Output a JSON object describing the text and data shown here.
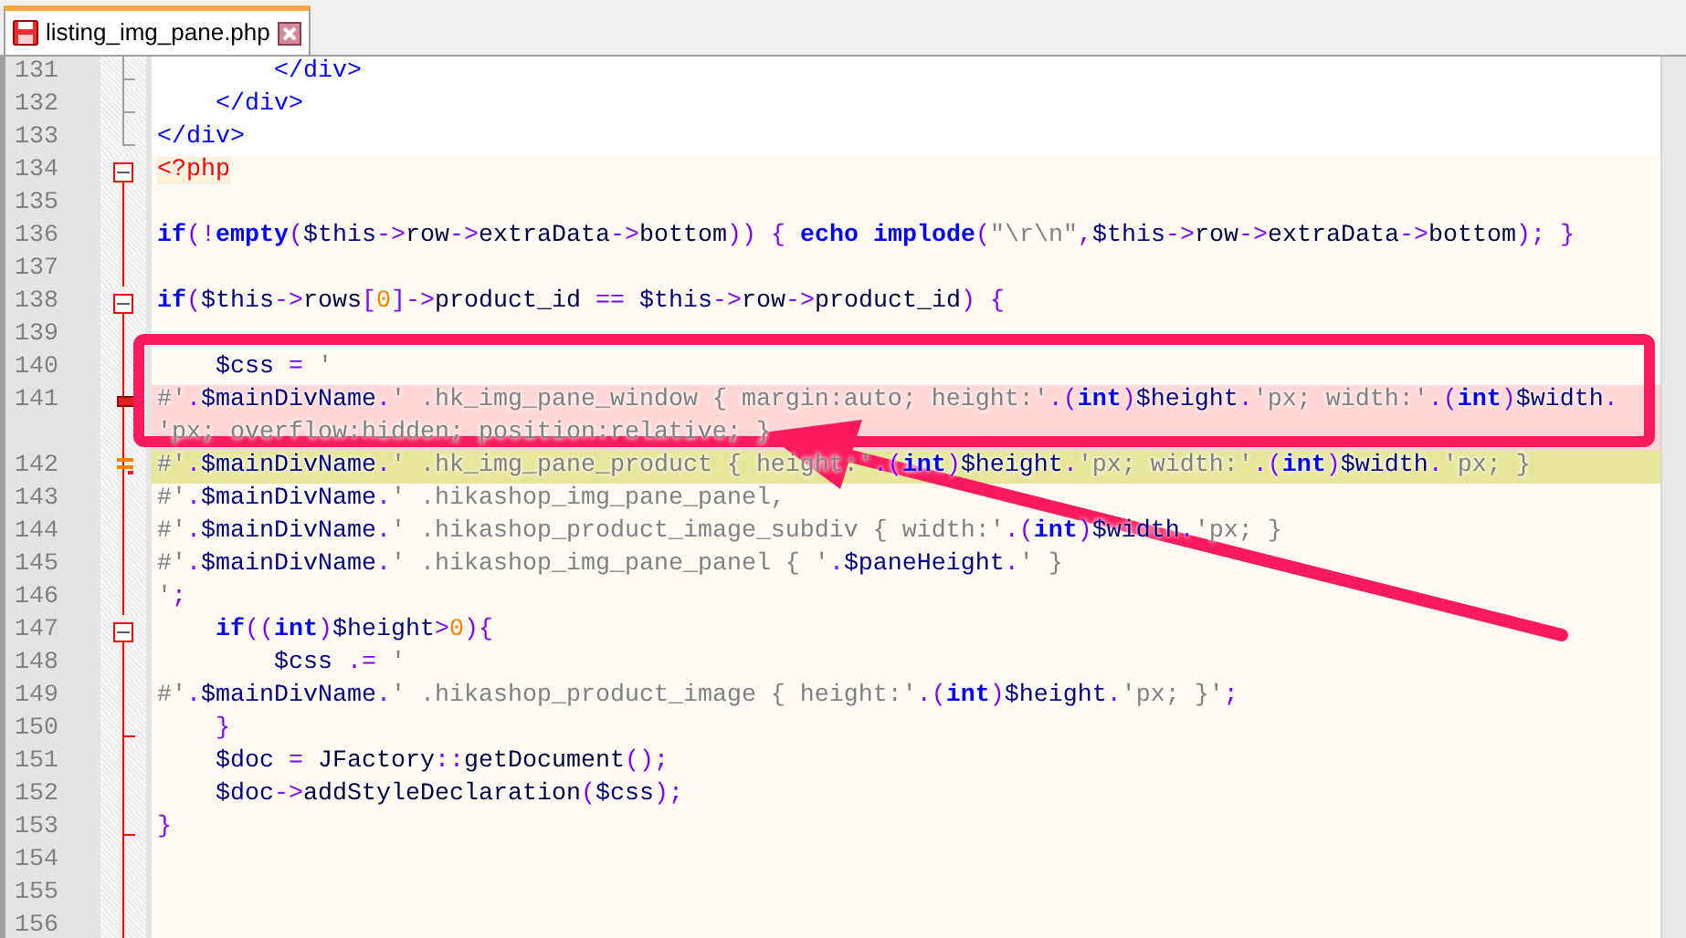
{
  "tabs": [
    {
      "label": "listing_img_pane.php",
      "selected": true
    }
  ],
  "lines": [
    {
      "number": "131",
      "color": "#a0a0a0",
      "kind": "tick",
      "bookmarked": false,
      "current": false,
      "changed": false,
      "rows": [
        "        </div>"
      ]
    },
    {
      "number": "132",
      "color": "#a0a0a0",
      "kind": "tick",
      "bookmarked": false,
      "current": false,
      "changed": false,
      "rows": [
        "    </div>"
      ]
    },
    {
      "number": "133",
      "color": "#a0a0a0",
      "kind": "end",
      "bookmarked": false,
      "current": false,
      "changed": false,
      "rows": [
        "</div>"
      ]
    },
    {
      "number": "134",
      "color": "#ff0000",
      "kind": "start",
      "bookmarked": false,
      "current": false,
      "changed": false,
      "rows": [
        "<?php"
      ]
    },
    {
      "number": "135",
      "color": "#ff0000",
      "kind": "line",
      "bookmarked": false,
      "current": false,
      "changed": false
    },
    {
      "number": "136",
      "color": "#ff0000",
      "kind": "line",
      "bookmarked": false,
      "current": false,
      "changed": false,
      "rows": [
        "if(!empty($this->row->extraData->bottom)) { echo implode(\"\\r\\n\",$this->row->extraData->bottom); }"
      ]
    },
    {
      "number": "137",
      "color": "#ff0000",
      "kind": "line",
      "bookmarked": false,
      "current": false,
      "changed": false
    },
    {
      "number": "138",
      "color": "#ff0000",
      "kind": "start",
      "bookmarked": false,
      "current": false,
      "changed": false,
      "rows": [
        "if($this->rows[0]->product_id == $this->row->product_id) {"
      ]
    },
    {
      "number": "139",
      "color": "#ff0000",
      "kind": "line",
      "bookmarked": false,
      "current": false,
      "changed": false
    },
    {
      "number": "140",
      "color": "#ff0000",
      "kind": "line",
      "bookmarked": false,
      "current": false,
      "changed": false,
      "rows": [
        "    $css = '"
      ]
    },
    {
      "number": "141",
      "color": "#ff0000",
      "kind": "line",
      "bookmarked": true,
      "current": false,
      "changed": false,
      "rows": [
        "#'.$mainDivName.' .hk_img_pane_window { margin:auto; height:'.(int)$height.'px; width:'.(int)$width.",
        "'px; overflow:hidden; position:relative; }"
      ]
    },
    {
      "number": "142",
      "color": "#ff0000",
      "kind": "line",
      "bookmarked": false,
      "current": true,
      "changed": true,
      "rows": [
        "#'.$mainDivName.' .hk_img_pane_product { height:'.(int)$height.'px; width:'.(int)$width.'px; }"
      ]
    },
    {
      "number": "143",
      "color": "#ff0000",
      "kind": "line",
      "bookmarked": false,
      "current": false,
      "changed": false,
      "rows": [
        "#'.$mainDivName.' .hikashop_img_pane_panel,"
      ]
    },
    {
      "number": "144",
      "color": "#ff0000",
      "kind": "line",
      "bookmarked": false,
      "current": false,
      "changed": false,
      "rows": [
        "#'.$mainDivName.' .hikashop_product_image_subdiv { width:'.(int)$width.'px; }"
      ]
    },
    {
      "number": "145",
      "color": "#ff0000",
      "kind": "line",
      "bookmarked": false,
      "current": false,
      "changed": false,
      "rows": [
        "#'.$mainDivName.' .hikashop_img_pane_panel { '.$paneHeight.' }"
      ]
    },
    {
      "number": "146",
      "color": "#ff0000",
      "kind": "line",
      "bookmarked": false,
      "current": false,
      "changed": false,
      "rows": [
        "';"
      ]
    },
    {
      "number": "147",
      "color": "#ff0000",
      "kind": "start",
      "bookmarked": false,
      "current": false,
      "changed": false,
      "rows": [
        "    if((int)$height>0){"
      ]
    },
    {
      "number": "148",
      "color": "#ff0000",
      "kind": "line",
      "bookmarked": false,
      "current": false,
      "changed": false,
      "rows": [
        "        $css .= '"
      ]
    },
    {
      "number": "149",
      "color": "#ff0000",
      "kind": "line",
      "bookmarked": false,
      "current": false,
      "changed": false,
      "rows": [
        "#'.$mainDivName.' .hikashop_product_image { height:'.(int)$height.'px; }';"
      ]
    },
    {
      "number": "150",
      "color": "#ff0000",
      "kind": "tick",
      "bookmarked": false,
      "current": false,
      "changed": false,
      "rows": [
        "    }"
      ]
    },
    {
      "number": "151",
      "color": "#ff0000",
      "kind": "line",
      "bookmarked": false,
      "current": false,
      "changed": false,
      "rows": [
        "    $doc = JFactory::getDocument();"
      ]
    },
    {
      "number": "152",
      "color": "#ff0000",
      "kind": "line",
      "bookmarked": false,
      "current": false,
      "changed": false,
      "rows": [
        "    $doc->addStyleDeclaration($css);"
      ]
    },
    {
      "number": "153",
      "color": "#ff0000",
      "kind": "tick",
      "bookmarked": false,
      "current": false,
      "changed": false,
      "rows": [
        "}"
      ]
    },
    {
      "number": "154",
      "color": "#ff0000",
      "kind": "line",
      "bookmarked": false,
      "current": false,
      "changed": false
    },
    {
      "number": "155",
      "color": "#ff0000",
      "kind": "line",
      "bookmarked": false,
      "current": false,
      "changed": false
    },
    {
      "number": "156",
      "color": "#ff0000",
      "kind": "line",
      "bookmarked": false,
      "current": false,
      "changed": false
    }
  ]
}
